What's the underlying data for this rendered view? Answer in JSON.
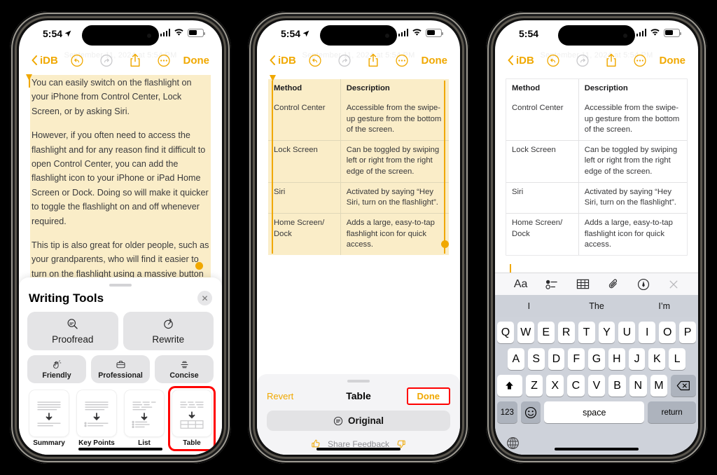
{
  "status_bar": {
    "time": "5:54",
    "location_icon": "location-arrow-icon",
    "cellular_icon": "cellular-bars-icon",
    "wifi_icon": "wifi-icon",
    "battery_icon": "battery-icon"
  },
  "nav_bar": {
    "back_label": "iDB",
    "undo_icon": "undo-icon",
    "redo_icon": "redo-icon",
    "share_icon": "share-icon",
    "more_icon": "more-ellipsis-icon",
    "done_label": "Done",
    "ghost_date": "September 11, 2024 at 5:54 PM"
  },
  "note_text": {
    "paragraph_1": "You can easily switch on the flashlight on your iPhone from Control Center, Lock Screen, or by asking Siri.",
    "paragraph_2": "However, if you often need to access the flashlight and for any reason find it difficult to open Control Center, you can add the flashlight icon to your iPhone or iPad Home Screen or Dock. Doing so will make it quicker to toggle the flashlight on and off whenever required.",
    "paragraph_3": "This tip is also great for older people, such as your grandparents, who will find it easier to turn on the flashlight using a massive button on the Home Screen, as opposed to other methods."
  },
  "writing_tools": {
    "title": "Writing Tools",
    "close_icon": "close-x-icon",
    "primary": [
      {
        "label": "Proofread",
        "icon": "proofread-magnifier-icon"
      },
      {
        "label": "Rewrite",
        "icon": "rewrite-clock-icon"
      }
    ],
    "tones": [
      {
        "label": "Friendly",
        "icon": "friendly-hand-wave-icon"
      },
      {
        "label": "Professional",
        "icon": "professional-briefcase-icon"
      },
      {
        "label": "Concise",
        "icon": "concise-condense-icon"
      }
    ],
    "formats": [
      {
        "label": "Summary",
        "icon": "summary-card-icon",
        "selected": false
      },
      {
        "label": "Key Points",
        "icon": "key-points-card-icon",
        "selected": false
      },
      {
        "label": "List",
        "icon": "list-card-icon",
        "selected": false
      },
      {
        "label": "Table",
        "icon": "table-card-icon",
        "selected": true
      }
    ]
  },
  "table": {
    "headers": [
      "Method",
      "Description"
    ],
    "rows": [
      [
        "Control Center",
        "Accessible from the swipe-up gesture from the bottom of the screen."
      ],
      [
        "Lock Screen",
        "Can be toggled by swiping left or right from the right edge of the screen."
      ],
      [
        "Siri",
        "Activated by saying “Hey Siri, turn on the flashlight”."
      ],
      [
        "Home Screen/ Dock",
        "Adds a large, easy-to-tap flashlight icon for quick access."
      ]
    ]
  },
  "result_panel": {
    "revert_label": "Revert",
    "title": "Table",
    "done_label": "Done",
    "original_label": "Original",
    "original_icon": "revert-original-icon",
    "feedback_label": "Share Feedback",
    "thumbs_up_icon": "thumbs-up-icon",
    "thumbs_down_icon": "thumbs-down-icon"
  },
  "keyboard": {
    "toolbar_icons": [
      "format-aa-icon",
      "checklist-icon",
      "table-icon",
      "attachment-paperclip-icon",
      "markup-pen-icon",
      "close-keyboard-icon"
    ],
    "predictions": [
      "I",
      "The",
      "I’m"
    ],
    "row1": [
      "Q",
      "W",
      "E",
      "R",
      "T",
      "Y",
      "U",
      "I",
      "O",
      "P"
    ],
    "row2": [
      "A",
      "S",
      "D",
      "F",
      "G",
      "H",
      "J",
      "K",
      "L"
    ],
    "row3": [
      "Z",
      "X",
      "C",
      "V",
      "B",
      "N",
      "M"
    ],
    "shift_icon": "shift-up-arrow-icon",
    "backspace_icon": "backspace-delete-icon",
    "numbers_label": "123",
    "emoji_icon": "emoji-smiley-icon",
    "space_label": "space",
    "return_label": "return",
    "globe_icon": "globe-language-icon"
  },
  "colors": {
    "accent": "#f0a800",
    "highlight": "#faedc8",
    "selection_red": "#ff0000",
    "keyboard_bg": "#ced2da"
  }
}
